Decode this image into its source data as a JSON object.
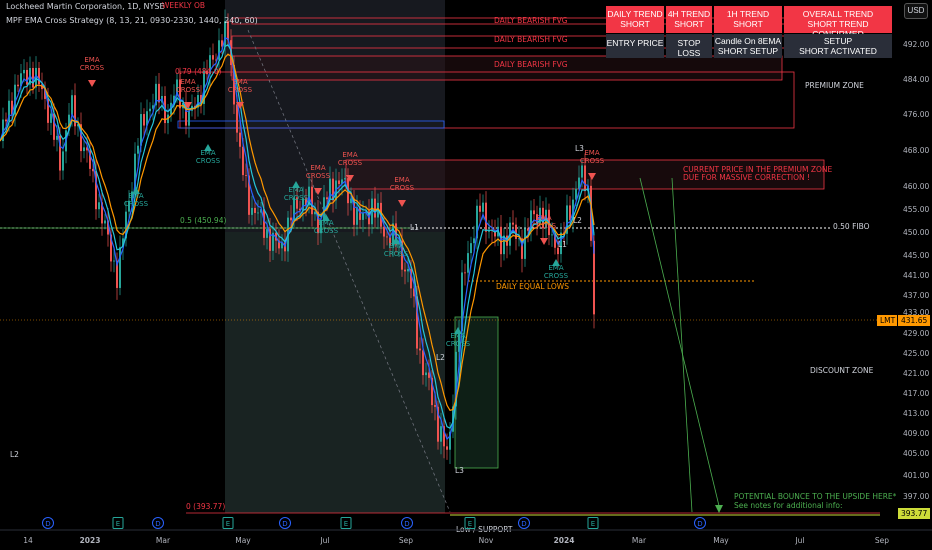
{
  "header": {
    "title": "Lockheed Martin Corporation, 1D, NYSE",
    "indicator": "MPF EMA Cross Strategy (8, 13, 21, 0930-2330, 1440, 240, 60)"
  },
  "currency_button": "USD",
  "ticker": {
    "symbol": "LMT",
    "price": "431.65"
  },
  "trend_table": {
    "row1": [
      "DAILY TREND\nSHORT",
      "4H TREND\nSHORT",
      "1H TREND\nSHORT",
      "OVERALL TREND\nSHORT TREND CONFIRMED"
    ],
    "row2": [
      "ENTRY PRICE",
      "STOP LOSS",
      "Candle On 8EMA\nSHORT SETUP",
      "SETUP\nSHORT ACTIVATED"
    ]
  },
  "colors": {
    "up": "#26a69a",
    "down": "#ef5350",
    "ema_fast": "#2962ff",
    "ema_mid": "#26c6da",
    "ema_slow": "#ff9800",
    "zone_red": "#f23645",
    "green": "#4caf50"
  },
  "chart_data": {
    "type": "candlestick",
    "ylim": [
      393.77,
      495
    ],
    "y_ticks": [
      "492.00",
      "484.00",
      "476.00",
      "468.00",
      "460.00",
      "455.00",
      "450.00",
      "445.00",
      "441.00",
      "437.00",
      "433.00",
      "429.00",
      "425.00",
      "421.00",
      "417.00",
      "413.00",
      "409.00",
      "405.00",
      "401.00",
      "397.00",
      "393.77"
    ],
    "x_ticks": [
      "14",
      "2023",
      "Mar",
      "May",
      "Jul",
      "Sep",
      "Nov",
      "2024",
      "Mar",
      "May",
      "Jul",
      "Sep"
    ],
    "series_path": [
      [
        0,
        470
      ],
      [
        15,
        482
      ],
      [
        30,
        486
      ],
      [
        45,
        480
      ],
      [
        60,
        465
      ],
      [
        70,
        478
      ],
      [
        85,
        468
      ],
      [
        100,
        455
      ],
      [
        110,
        446
      ],
      [
        118,
        441
      ],
      [
        128,
        456
      ],
      [
        138,
        470
      ],
      [
        148,
        478
      ],
      [
        158,
        480
      ],
      [
        168,
        476
      ],
      [
        178,
        482
      ],
      [
        188,
        474
      ],
      [
        198,
        480
      ],
      [
        208,
        486
      ],
      [
        218,
        492
      ],
      [
        228,
        494
      ],
      [
        234,
        480
      ],
      [
        240,
        466
      ],
      [
        250,
        456
      ],
      [
        262,
        452
      ],
      [
        272,
        448
      ],
      [
        280,
        446
      ],
      [
        292,
        454
      ],
      [
        305,
        458
      ],
      [
        318,
        452
      ],
      [
        328,
        458
      ],
      [
        338,
        462
      ],
      [
        348,
        458
      ],
      [
        360,
        452
      ],
      [
        372,
        456
      ],
      [
        384,
        450
      ],
      [
        396,
        448
      ],
      [
        410,
        440
      ],
      [
        418,
        427
      ],
      [
        426,
        420
      ],
      [
        434,
        414
      ],
      [
        442,
        408
      ],
      [
        448,
        403
      ],
      [
        454,
        420
      ],
      [
        462,
        438
      ],
      [
        470,
        448
      ],
      [
        480,
        455
      ],
      [
        490,
        451
      ],
      [
        500,
        447
      ],
      [
        510,
        451
      ],
      [
        520,
        447
      ],
      [
        530,
        452
      ],
      [
        540,
        455
      ],
      [
        550,
        449
      ],
      [
        560,
        447
      ],
      [
        570,
        455
      ],
      [
        578,
        462
      ],
      [
        584,
        461
      ],
      [
        590,
        458
      ],
      [
        594,
        431.65
      ]
    ],
    "annotations": [
      {
        "text": "WEEKLY OB",
        "x": 162,
        "y": 8,
        "color": "#f23645"
      },
      {
        "text": "DAILY BEARISH FVG",
        "x": 494,
        "y": 23,
        "color": "#f23645"
      },
      {
        "text": "DAILY BEARISH FVG",
        "x": 494,
        "y": 42,
        "color": "#f23645"
      },
      {
        "text": "DAILY BEARISH FVG",
        "x": 494,
        "y": 67,
        "color": "#f23645"
      },
      {
        "text": "PREMIUM ZONE",
        "x": 805,
        "y": 88,
        "color": "#d1d4dc"
      },
      {
        "text": "0.79 (484.0)",
        "x": 175,
        "y": 74,
        "color": "#f23645"
      },
      {
        "text": "0.5 (450.94)",
        "x": 180,
        "y": 223,
        "color": "#4caf50"
      },
      {
        "text": "0 (393.77)",
        "x": 186,
        "y": 509,
        "color": "#f23645"
      },
      {
        "text": "0.50 FIBO",
        "x": 833,
        "y": 229,
        "color": "#d1d4dc"
      },
      {
        "text": "CURRENT PRICE IN THE PREMIUM ZONE",
        "x": 683,
        "y": 172,
        "color": "#f23645"
      },
      {
        "text": "DUE FOR MASSIVE CORRECTION !",
        "x": 683,
        "y": 180,
        "color": "#f23645"
      },
      {
        "text": "DAILY EQUAL LOWS",
        "x": 496,
        "y": 289,
        "color": "#ff9800"
      },
      {
        "text": "DISCOUNT ZONE",
        "x": 810,
        "y": 373,
        "color": "#d1d4dc"
      },
      {
        "text": "POTENTIAL BOUNCE TO THE UPSIDE HERE*",
        "x": 734,
        "y": 499,
        "color": "#4caf50"
      },
      {
        "text": "See notes for additional info:",
        "x": 734,
        "y": 508,
        "color": "#4caf50"
      },
      {
        "text": "Low / SUPPORT",
        "x": 456,
        "y": 532,
        "color": "#d1d4dc"
      },
      {
        "text": "L1",
        "x": 410,
        "y": 230,
        "color": "#d1d4dc"
      },
      {
        "text": "L1",
        "x": 558,
        "y": 247,
        "color": "#d1d4dc"
      },
      {
        "text": "L2",
        "x": 436,
        "y": 360,
        "color": "#d1d4dc"
      },
      {
        "text": "L2",
        "x": 573,
        "y": 223,
        "color": "#d1d4dc"
      },
      {
        "text": "L2",
        "x": 10,
        "y": 457,
        "color": "#d1d4dc"
      },
      {
        "text": "L3",
        "x": 455,
        "y": 473,
        "color": "#d1d4dc"
      },
      {
        "text": "L3",
        "x": 575,
        "y": 151,
        "color": "#d1d4dc"
      }
    ],
    "ema_labels": [
      {
        "text": "EMA\nCROSS",
        "x": 92,
        "y": 62,
        "dir": "down"
      },
      {
        "text": "EMA\nCROSS",
        "x": 188,
        "y": 84,
        "dir": "down"
      },
      {
        "text": "EMA\nCROSS",
        "x": 240,
        "y": 84,
        "dir": "down"
      },
      {
        "text": "EMA\nCROSS",
        "x": 136,
        "y": 198,
        "dir": "up"
      },
      {
        "text": "EMA\nCROSS",
        "x": 208,
        "y": 155,
        "dir": "up"
      },
      {
        "text": "EMA\nCROSS",
        "x": 296,
        "y": 192,
        "dir": "up"
      },
      {
        "text": "EMA\nCROSS",
        "x": 318,
        "y": 170,
        "dir": "down"
      },
      {
        "text": "EMA\nCROSS",
        "x": 326,
        "y": 225,
        "dir": "up"
      },
      {
        "text": "EMA\nCROSS",
        "x": 350,
        "y": 157,
        "dir": "down"
      },
      {
        "text": "EMA\nCROSS",
        "x": 402,
        "y": 182,
        "dir": "down"
      },
      {
        "text": "EMA\nCROSS",
        "x": 396,
        "y": 248,
        "dir": "up"
      },
      {
        "text": "EMA\nCROSS",
        "x": 458,
        "y": 338,
        "dir": "up"
      },
      {
        "text": "EMA\nCROSS",
        "x": 544,
        "y": 220,
        "dir": "down"
      },
      {
        "text": "EMA\nCROSS",
        "x": 556,
        "y": 270,
        "dir": "up"
      },
      {
        "text": "EMA\nCROSS",
        "x": 592,
        "y": 155,
        "dir": "down"
      }
    ],
    "events": [
      "D",
      "E",
      "D",
      "E",
      "D",
      "E",
      "D",
      "E",
      "D",
      "E",
      "D",
      "E",
      "D",
      "E"
    ]
  }
}
